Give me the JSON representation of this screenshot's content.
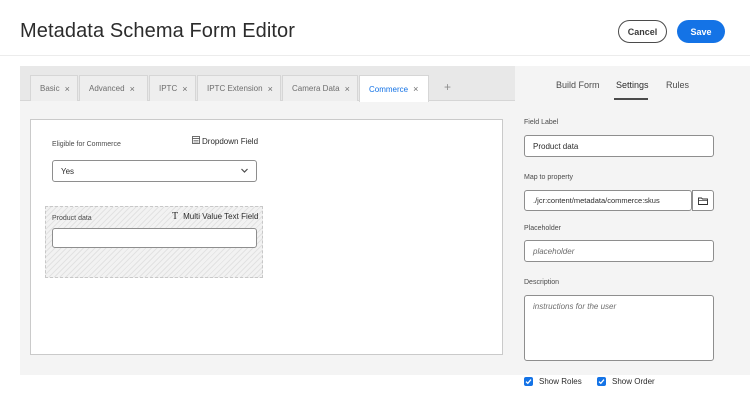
{
  "header": {
    "title": "Metadata Schema Form Editor",
    "cancel_label": "Cancel",
    "save_label": "Save"
  },
  "tabs": [
    {
      "label": "Basic",
      "active": false
    },
    {
      "label": "Advanced",
      "active": false
    },
    {
      "label": "IPTC",
      "active": false
    },
    {
      "label": "IPTC Extension",
      "active": false
    },
    {
      "label": "Camera Data",
      "active": false
    },
    {
      "label": "Commerce",
      "active": true
    }
  ],
  "tab_add": "+",
  "tab_close": "×",
  "form": {
    "dropdown": {
      "label": "Eligible for Commerce",
      "type_label": "Dropdown Field",
      "value": "Yes"
    },
    "multitext": {
      "label": "Product data",
      "type_label": "Multi Value Text Field",
      "type_glyph": "T"
    }
  },
  "right_panel": {
    "tabs": [
      {
        "label": "Build Form",
        "active": false
      },
      {
        "label": "Settings",
        "active": true
      },
      {
        "label": "Rules",
        "active": false
      }
    ],
    "field_label": {
      "label": "Field Label",
      "value": "Product data"
    },
    "map_to_property": {
      "label": "Map to property",
      "value": "./jcr:content/metadata/commerce:skus"
    },
    "placeholder": {
      "label": "Placeholder",
      "value": "placeholder"
    },
    "description": {
      "label": "Description",
      "value": "instructions for the user"
    }
  },
  "footer": {
    "show_roles": {
      "label": "Show Roles",
      "checked": true
    },
    "show_order": {
      "label": "Show Order",
      "checked": true
    }
  },
  "colors": {
    "accent": "#1473e6"
  }
}
